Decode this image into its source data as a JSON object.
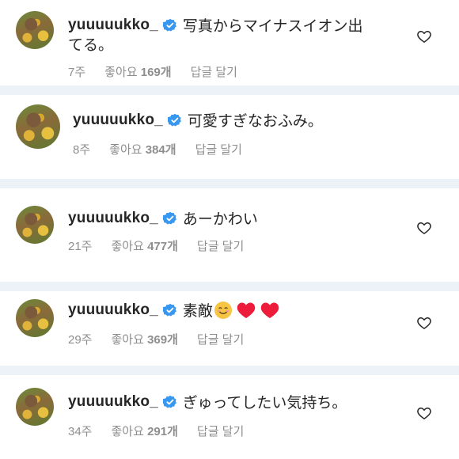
{
  "comments": [
    {
      "username": "yuuuuukko_",
      "text_line1": "写真からマイナスイオン出",
      "text_line2": "てる。",
      "time": "7주",
      "likes_label": "좋아요",
      "likes_count": "169개",
      "reply_label": "답글 달기"
    },
    {
      "username": "yuuuuukko_",
      "text": "可愛すぎなおふみ。",
      "time": "8주",
      "likes_label": "좋아요",
      "likes_count": "384개",
      "reply_label": "답글 달기"
    },
    {
      "username": "yuuuuukko_",
      "text": "あーかわい",
      "time": "21주",
      "likes_label": "좋아요",
      "likes_count": "477개",
      "reply_label": "답글 달기"
    },
    {
      "username": "yuuuuukko_",
      "text": "素敵",
      "time": "29주",
      "likes_label": "좋아요",
      "likes_count": "369개",
      "reply_label": "답글 달기"
    },
    {
      "username": "yuuuuukko_",
      "text": "ぎゅってしたい気持ち。",
      "time": "34주",
      "likes_label": "좋아요",
      "likes_count": "291개",
      "reply_label": "답글 달기"
    }
  ],
  "colors": {
    "verified_blue": "#3897f0",
    "separator": "#edf1f8",
    "meta_gray": "#8e8e8e",
    "text": "#262626",
    "heart_red": "#ed1c3a"
  },
  "icons": [
    "verified-badge-icon",
    "heart-outline-icon",
    "smiling-face-emoji",
    "red-heart-emoji"
  ]
}
